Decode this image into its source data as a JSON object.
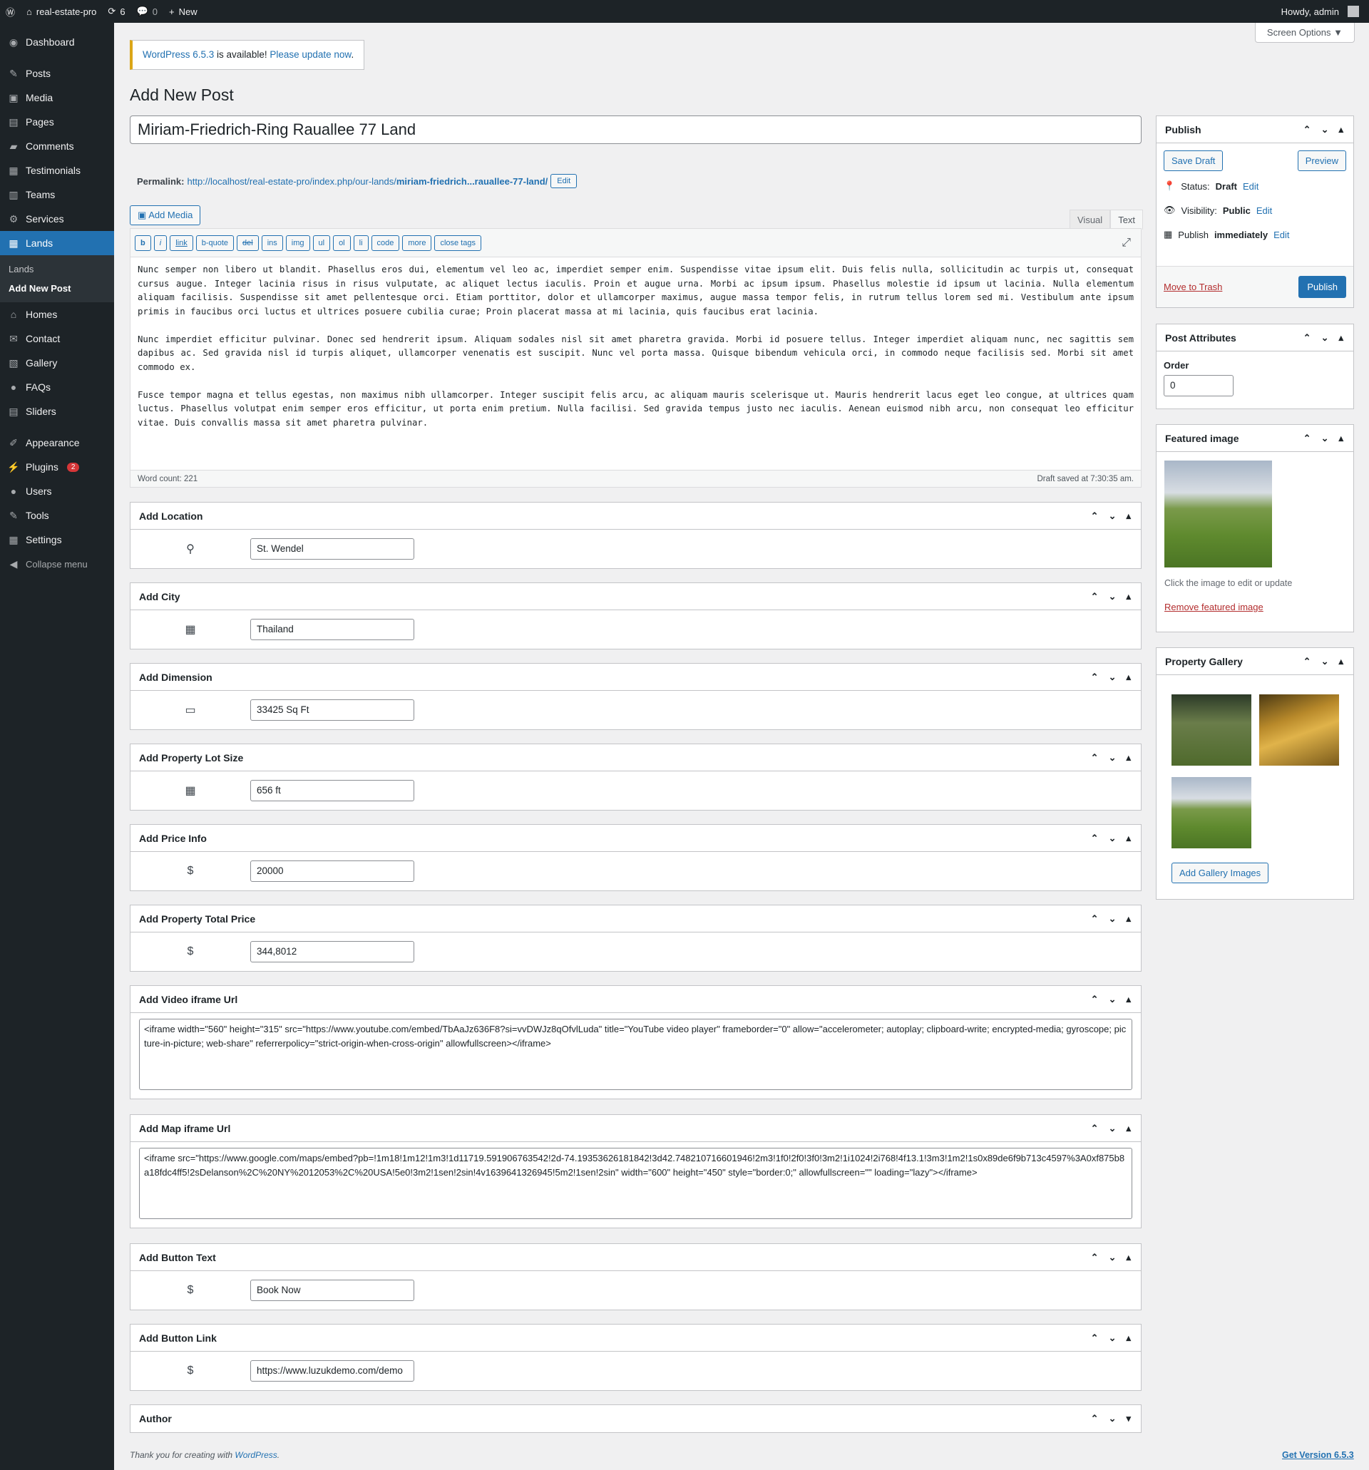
{
  "adminbar": {
    "site_name": "real-estate-pro",
    "updates": "6",
    "comments": "0",
    "new_label": "New",
    "howdy": "Howdy, admin"
  },
  "sidebar": {
    "items": [
      {
        "label": "Dashboard",
        "icon": "dashboard-icon"
      },
      {
        "label": "Posts",
        "icon": "pin-icon"
      },
      {
        "label": "Media",
        "icon": "media-icon"
      },
      {
        "label": "Pages",
        "icon": "page-icon"
      },
      {
        "label": "Comments",
        "icon": "comment-icon"
      },
      {
        "label": "Testimonials",
        "icon": "testimonial-icon"
      },
      {
        "label": "Teams",
        "icon": "team-icon"
      },
      {
        "label": "Services",
        "icon": "gear-icon"
      },
      {
        "label": "Lands",
        "icon": "grid-icon"
      },
      {
        "label": "Homes",
        "icon": "home-icon"
      },
      {
        "label": "Contact",
        "icon": "mail-icon"
      },
      {
        "label": "Gallery",
        "icon": "gallery-icon"
      },
      {
        "label": "FAQs",
        "icon": "faq-icon"
      },
      {
        "label": "Sliders",
        "icon": "slider-icon"
      },
      {
        "label": "Appearance",
        "icon": "brush-icon"
      },
      {
        "label": "Plugins",
        "icon": "plugin-icon",
        "badge": "2"
      },
      {
        "label": "Users",
        "icon": "user-icon"
      },
      {
        "label": "Tools",
        "icon": "wrench-icon"
      },
      {
        "label": "Settings",
        "icon": "settings-icon"
      }
    ],
    "submenu": [
      "Lands",
      "Add New Post"
    ],
    "collapse": "Collapse menu"
  },
  "screen_options": "Screen Options ▼",
  "notice": {
    "link1": "WordPress 6.5.3",
    "text": " is available! ",
    "link2": "Please update now",
    "end": "."
  },
  "page_title": "Add New Post",
  "post_title": "Miriam-Friedrich-Ring Rauallee 77 Land",
  "permalink": {
    "label": "Permalink:",
    "url_base": "http://localhost/real-estate-pro/index.php/our-lands/",
    "slug": "miriam-friedrich...rauallee-77-land/",
    "edit": "Edit"
  },
  "add_media": "Add Media",
  "editor_tabs": [
    "Visual",
    "Text"
  ],
  "quicktags": [
    "b",
    "i",
    "link",
    "b-quote",
    "del",
    "ins",
    "img",
    "ul",
    "ol",
    "li",
    "code",
    "more",
    "close tags"
  ],
  "content": [
    "Nunc semper non libero ut blandit. Phasellus eros dui, elementum vel leo ac, imperdiet semper enim. Suspendisse vitae ipsum elit. Duis felis nulla, sollicitudin ac turpis ut, consequat cursus augue. Integer lacinia risus in risus vulputate, ac aliquet lectus iaculis. Proin et augue urna. Morbi ac ipsum ipsum. Phasellus molestie id ipsum ut lacinia. Nulla elementum aliquam facilisis. Suspendisse sit amet pellentesque orci. Etiam porttitor, dolor et ullamcorper maximus, augue massa tempor felis, in rutrum tellus lorem sed mi. Vestibulum ante ipsum primis in faucibus orci luctus et ultrices posuere cubilia curae; Proin placerat massa at mi lacinia, quis faucibus erat lacinia.",
    "Nunc imperdiet efficitur pulvinar. Donec sed hendrerit ipsum. Aliquam sodales nisl sit amet pharetra gravida. Morbi id posuere tellus. Integer imperdiet aliquam nunc, nec sagittis sem dapibus ac. Sed gravida nisl id turpis aliquet, ullamcorper venenatis est suscipit. Nunc vel porta massa. Quisque bibendum vehicula orci, in commodo neque facilisis sed. Morbi sit amet commodo ex.",
    "Fusce tempor magna et tellus egestas, non maximus nibh ullamcorper. Integer suscipit felis arcu, ac aliquam mauris scelerisque ut. Mauris hendrerit lacus eget leo congue, at ultrices quam luctus. Phasellus volutpat enim semper eros efficitur, ut porta enim pretium. Nulla facilisi. Sed gravida tempus justo nec iaculis. Aenean euismod nibh arcu, non consequat leo efficitur vitae. Duis convallis massa sit amet pharetra pulvinar."
  ],
  "word_count": "Word count: 221",
  "draft_saved": "Draft saved at 7:30:35 am.",
  "boxes": {
    "location": {
      "title": "Add Location",
      "value": "St. Wendel",
      "icon": "location-pin-icon"
    },
    "city": {
      "title": "Add City",
      "value": "Thailand",
      "icon": "building-icon"
    },
    "dimension": {
      "title": "Add Dimension",
      "value": "33425 Sq Ft",
      "icon": "rectangle-icon"
    },
    "lot": {
      "title": "Add Property Lot Size",
      "value": "656 ft",
      "icon": "building-icon"
    },
    "price": {
      "title": "Add Price Info",
      "value": "20000",
      "icon": "dollar-icon"
    },
    "total": {
      "title": "Add Property Total Price",
      "value": "344,8012",
      "icon": "dollar-icon"
    },
    "video": {
      "title": "Add Video iframe Url",
      "value": "<iframe width=\"560\" height=\"315\" src=\"https://www.youtube.com/embed/TbAaJz636F8?si=vvDWJz8qOfvlLuda\" title=\"YouTube video player\" frameborder=\"0\" allow=\"accelerometer; autoplay; clipboard-write; encrypted-media; gyroscope; picture-in-picture; web-share\" referrerpolicy=\"strict-origin-when-cross-origin\" allowfullscreen></iframe>"
    },
    "map": {
      "title": "Add Map iframe Url",
      "value": "<iframe src=\"https://www.google.com/maps/embed?pb=!1m18!1m12!1m3!1d11719.591906763542!2d-74.19353626181842!3d42.748210716601946!2m3!1f0!2f0!3f0!3m2!1i1024!2i768!4f13.1!3m3!1m2!1s0x89de6f9b713c4597%3A0xf875b8a18fdc4ff5!2sDelanson%2C%20NY%2012053%2C%20USA!5e0!3m2!1sen!2sin!4v1639641326945!5m2!1sen!2sin\" width=\"600\" height=\"450\" style=\"border:0;\" allowfullscreen=\"\" loading=\"lazy\"></iframe>"
    },
    "btn_text": {
      "title": "Add Button Text",
      "value": "Book Now",
      "icon": "dollar-icon"
    },
    "btn_link": {
      "title": "Add Button Link",
      "value": "https://www.luzukdemo.com/demo",
      "icon": "dollar-icon"
    },
    "author": {
      "title": "Author"
    }
  },
  "publish": {
    "title": "Publish",
    "save_draft": "Save Draft",
    "preview": "Preview",
    "status_label": "Status:",
    "status": "Draft",
    "visibility_label": "Visibility:",
    "visibility": "Public",
    "publish_label": "Publish",
    "publish_when": "immediately",
    "edit": "Edit",
    "trash": "Move to Trash",
    "publish_btn": "Publish"
  },
  "attributes": {
    "title": "Post Attributes",
    "order_label": "Order",
    "order_value": "0"
  },
  "featured": {
    "title": "Featured image",
    "hint": "Click the image to edit or update",
    "remove": "Remove featured image"
  },
  "gallery": {
    "title": "Property Gallery",
    "add": "Add Gallery Images"
  },
  "footer": {
    "text": "Thank you for creating with ",
    "link": "WordPress",
    "end": ".",
    "version": "Get Version 6.5.3"
  },
  "colors": {
    "accent": "#2271b1",
    "sidebar": "#1d2327",
    "notice": "#dba617",
    "danger": "#d63638"
  }
}
